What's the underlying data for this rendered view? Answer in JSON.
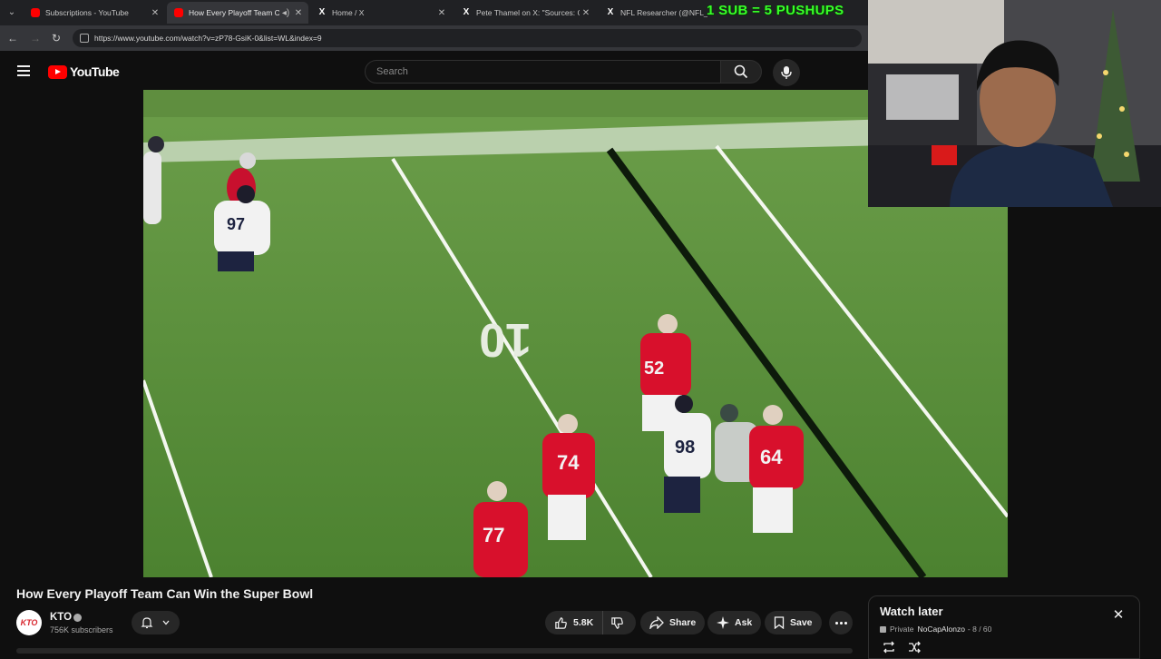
{
  "browser": {
    "tabs": [
      {
        "label": "Subscriptions - YouTube",
        "icon": "youtube-icon"
      },
      {
        "label": "How Every Playoff Team Ca",
        "icon": "youtube-icon",
        "active": true
      },
      {
        "label": "Home / X",
        "icon": "x-icon"
      },
      {
        "label": "Pete Thamel on X: \"Sources: Oh",
        "icon": "x-icon"
      },
      {
        "label": "NFL Researcher (@NFL_Rese",
        "icon": "x-icon"
      }
    ],
    "url": "https://www.youtube.com/watch?v=zP78-GsiK-0&list=WL&index=9"
  },
  "youtube": {
    "logo_text": "YouTube",
    "search_placeholder": "Search"
  },
  "stream_overlay": {
    "text": "1 SUB = 5 PUSHUPS"
  },
  "video": {
    "title": "How Every Playoff Team Can Win the Super Bowl",
    "field_number": "10",
    "jerseys": [
      "97",
      "52",
      "74",
      "98",
      "64",
      "77"
    ]
  },
  "channel": {
    "name": "KTO",
    "avatar_text": "KTO",
    "subscribers": "756K subscribers"
  },
  "actions": {
    "likes": "5.8K",
    "share": "Share",
    "ask": "Ask",
    "save": "Save"
  },
  "playlist": {
    "title": "Watch later",
    "privacy": "Private",
    "owner": "NoCapAlonzo",
    "position": "- 8 / 60"
  },
  "colors": {
    "accent": "#ff0000",
    "overlay_text": "#39ff2a",
    "background": "#0f0f0f"
  }
}
